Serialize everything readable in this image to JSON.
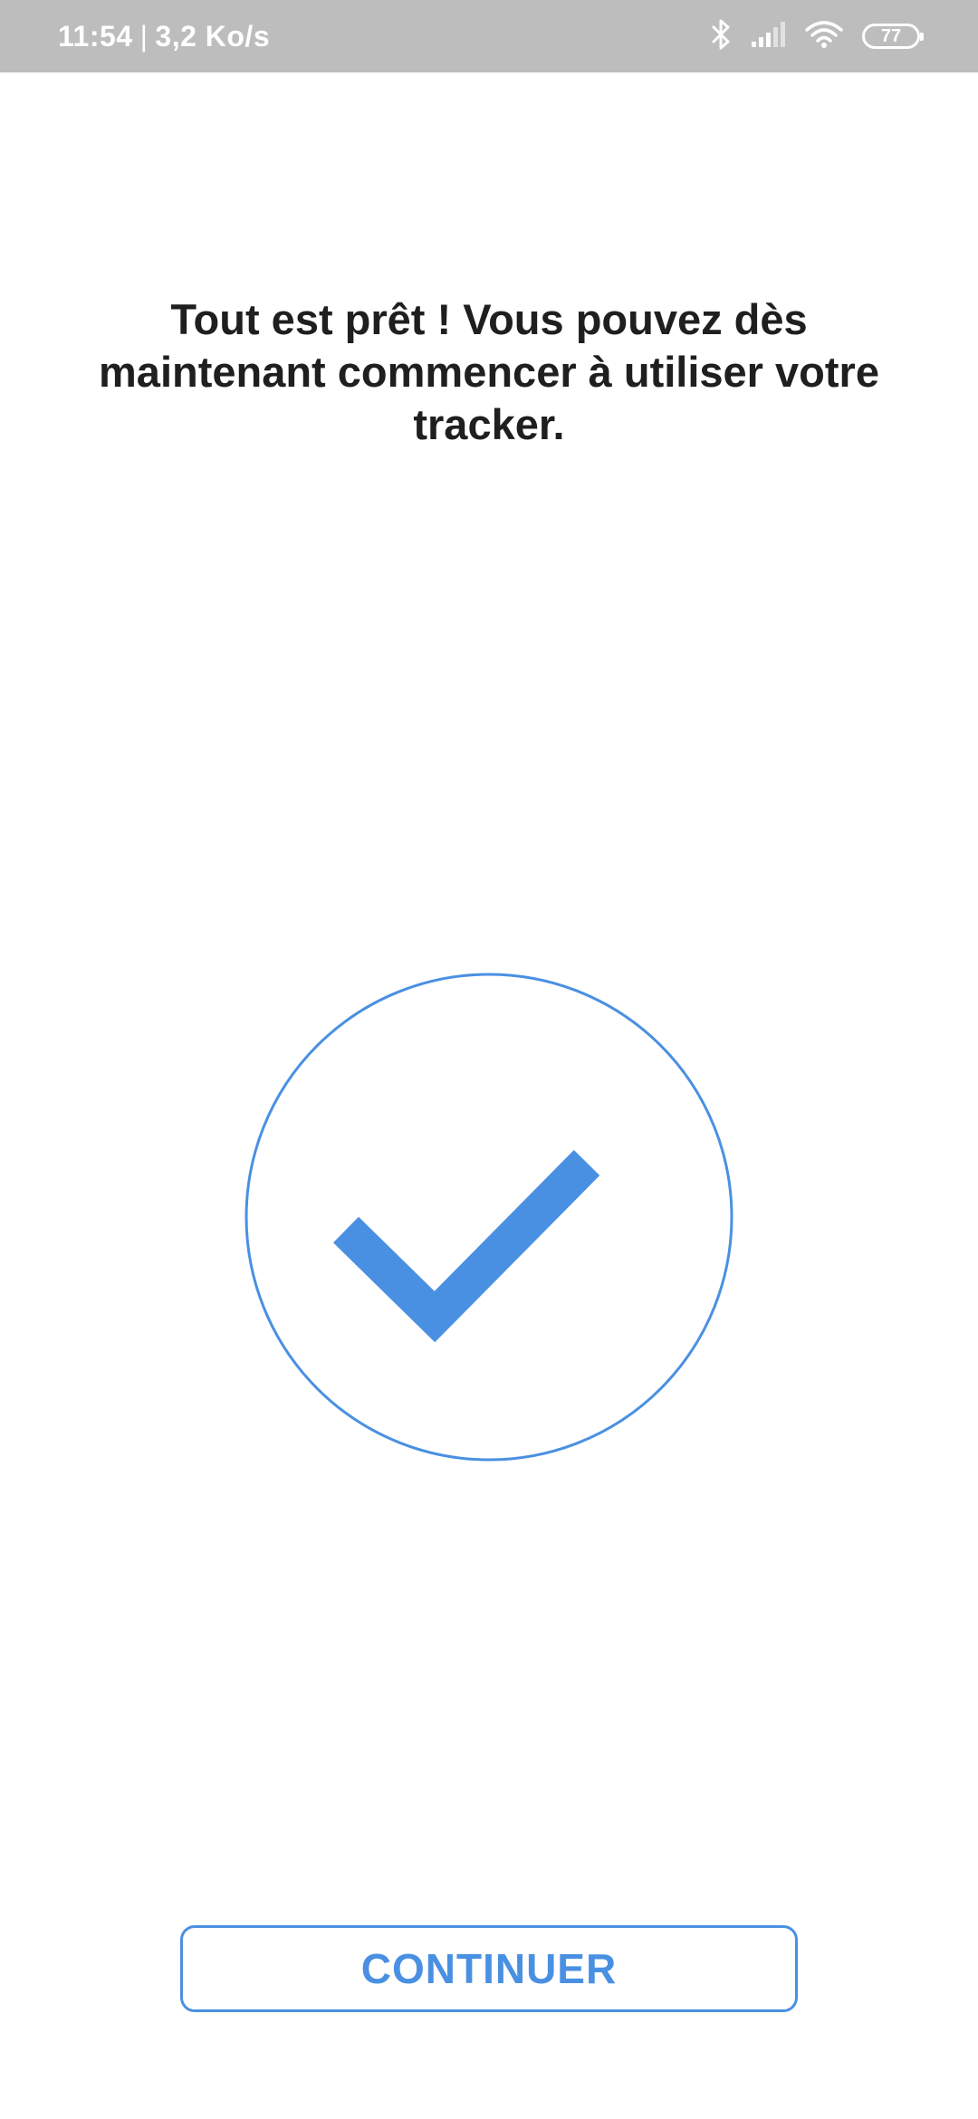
{
  "status_bar": {
    "time": "11:54",
    "separator": "|",
    "network_speed": "3,2 Ko/s",
    "battery_level": "77",
    "icons": [
      "bluetooth-icon",
      "signal-icon",
      "wifi-icon",
      "battery-icon"
    ]
  },
  "main": {
    "message": "Tout est prêt ! Vous pouvez dès maintenant commencer à utiliser votre tracker.",
    "success_icon": "checkmark-circle-icon"
  },
  "footer": {
    "continue_label": "CONTINUER"
  },
  "colors": {
    "accent": "#4a90e2",
    "status_bar": "#bdbdbd",
    "text": "#1f1f1f",
    "background": "#ffffff"
  }
}
